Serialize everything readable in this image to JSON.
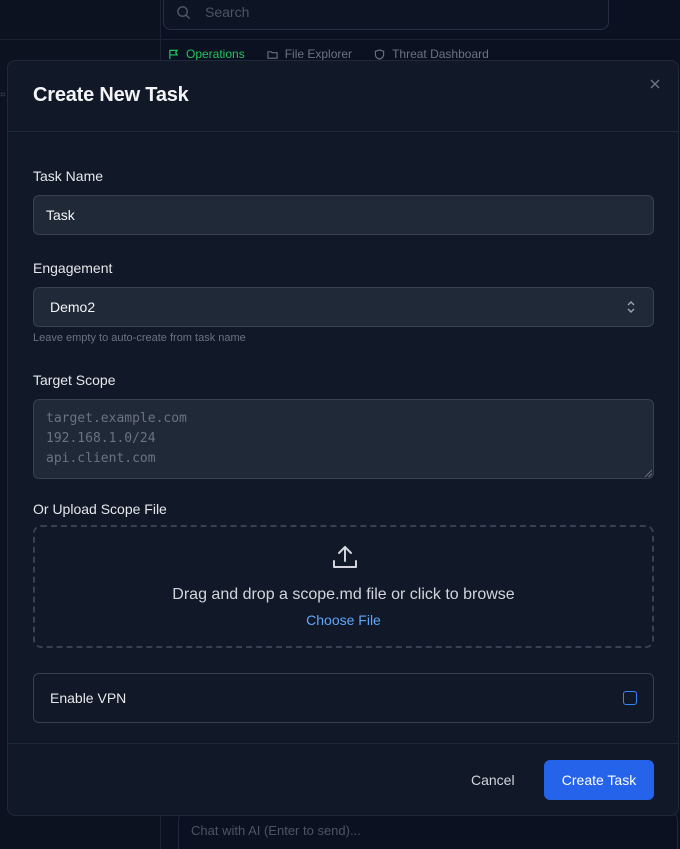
{
  "background": {
    "search_placeholder": "Search",
    "tabs": [
      {
        "label": "Operations",
        "icon": "flag-icon",
        "active": true
      },
      {
        "label": "File Explorer",
        "icon": "folder-icon",
        "active": false
      },
      {
        "label": "Threat Dashboard",
        "icon": "shield-icon",
        "active": false
      }
    ],
    "chat_placeholder": "Chat with AI (Enter to send)..."
  },
  "modal": {
    "title": "Create New Task",
    "close_icon": "close-icon",
    "task_name": {
      "label": "Task Name",
      "value": "Task"
    },
    "engagement": {
      "label": "Engagement",
      "value": "Demo2",
      "hint": "Leave empty to auto-create from task name"
    },
    "target_scope": {
      "label": "Target Scope",
      "placeholder": "target.example.com\n192.168.1.0/24\napi.client.com"
    },
    "upload": {
      "label": "Or Upload Scope File",
      "icon": "upload-icon",
      "text": "Drag and drop a scope.md file or click to browse",
      "button": "Choose File"
    },
    "vpn": {
      "label": "Enable VPN",
      "checked": false
    },
    "footer": {
      "cancel": "Cancel",
      "create": "Create Task"
    }
  },
  "colors": {
    "accent": "#2563eb",
    "link": "#60a5fa",
    "active_tab": "#22c55e",
    "modal_bg": "#111827"
  }
}
